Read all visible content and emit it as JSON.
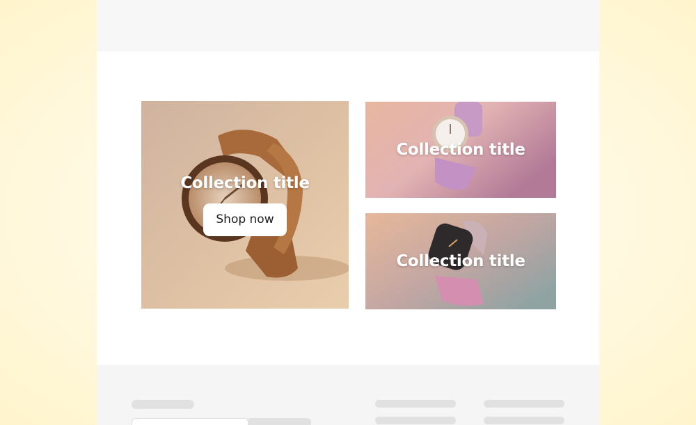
{
  "collections": {
    "main": {
      "title": "Collection title",
      "button_label": "Shop now",
      "image": "wooden-watch-image"
    },
    "top_right": {
      "title": "Collection title",
      "image": "pink-strap-watch-image"
    },
    "bottom_right": {
      "title": "Collection title",
      "image": "smartwatch-image"
    }
  },
  "colors": {
    "page_bg": "#ffffff",
    "outer_bg": "#fff6d6",
    "header_placeholder": "#f7f7f7",
    "footer_placeholder": "#f5f5f5",
    "skeleton": "#e1e1e1",
    "button_bg": "#ffffff",
    "button_text": "#1c1c1c"
  }
}
